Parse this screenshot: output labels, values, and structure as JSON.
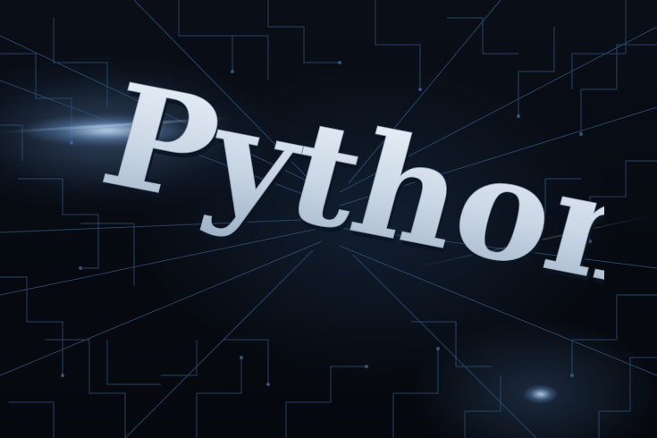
{
  "headline": {
    "text": "Python"
  },
  "colors": {
    "background": "#05070b",
    "circuit_line": "#2c4d74",
    "glow": "#9fc4ee",
    "text_fill_light": "#e6eef7",
    "text_fill_shade": "#a8b9cc"
  },
  "decor": {
    "motif": "circuit-board-lines",
    "light_flare": "left",
    "sparkle": "bottom-right"
  }
}
